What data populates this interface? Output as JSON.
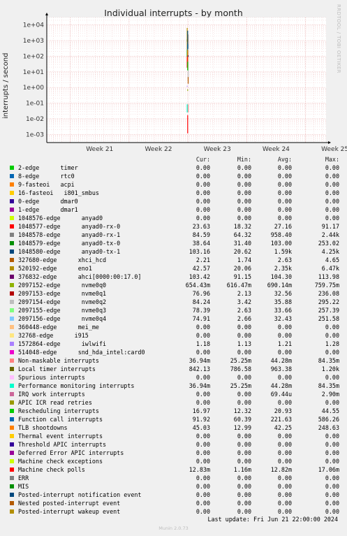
{
  "title": "Individual interrupts - by month",
  "vendor_text": "RRDTOOL / TOBI OETIKER",
  "footer": {
    "last_update": "Last update: Fri Jun 21 22:00:00 2024",
    "munin": "Munin 2.0.73"
  },
  "table": {
    "headers": [
      "Cur:",
      "Min:",
      "Avg:",
      "Max:"
    ],
    "rows": [
      {
        "name": "2-edge      timer",
        "color": "#00cc00",
        "cur": "0.00",
        "min": "0.00",
        "avg": "0.00",
        "max": "0.00"
      },
      {
        "name": "8-edge      rtc0",
        "color": "#0066b3",
        "cur": "0.00",
        "min": "0.00",
        "avg": "0.00",
        "max": "0.00"
      },
      {
        "name": "9-fasteoi   acpi",
        "color": "#ff8000",
        "cur": "0.00",
        "min": "0.00",
        "avg": "0.00",
        "max": "0.00"
      },
      {
        "name": "16-fasteoi   i801_smbus",
        "color": "#ffcc00",
        "cur": "0.00",
        "min": "0.00",
        "avg": "0.00",
        "max": "0.00"
      },
      {
        "name": "0-edge      dmar0",
        "color": "#330099",
        "cur": "0.00",
        "min": "0.00",
        "avg": "0.00",
        "max": "0.00"
      },
      {
        "name": "1-edge      dmar1",
        "color": "#990099",
        "cur": "0.00",
        "min": "0.00",
        "avg": "0.00",
        "max": "0.00"
      },
      {
        "name": "1048576-edge      anyad0",
        "color": "#ccff00",
        "cur": "0.00",
        "min": "0.00",
        "avg": "0.00",
        "max": "0.00"
      },
      {
        "name": "1048577-edge      anyad0-rx-0",
        "color": "#ff0000",
        "cur": "23.63",
        "min": "18.32",
        "avg": "27.16",
        "max": "91.17"
      },
      {
        "name": "1048578-edge      anyad0-rx-1",
        "color": "#808080",
        "cur": "84.59",
        "min": "64.32",
        "avg": "958.40",
        "max": "2.44k"
      },
      {
        "name": "1048579-edge      anyad0-tx-0",
        "color": "#008f00",
        "cur": "38.64",
        "min": "31.40",
        "avg": "103.00",
        "max": "253.02"
      },
      {
        "name": "1048580-edge      anyad0-tx-1",
        "color": "#00487d",
        "cur": "103.16",
        "min": "20.62",
        "avg": "1.59k",
        "max": "4.25k"
      },
      {
        "name": "327680-edge      xhci_hcd",
        "color": "#b35a00",
        "cur": "2.21",
        "min": "1.74",
        "avg": "2.63",
        "max": "4.65"
      },
      {
        "name": "520192-edge      eno1",
        "color": "#b38f00",
        "cur": "42.57",
        "min": "20.06",
        "avg": "2.35k",
        "max": "6.47k"
      },
      {
        "name": "376832-edge      ahci[0000:00:17.0]",
        "color": "#6b006b",
        "cur": "103.42",
        "min": "91.15",
        "avg": "104.30",
        "max": "113.98"
      },
      {
        "name": "2097152-edge      nvme0q0",
        "color": "#8fb300",
        "cur": "654.43m",
        "min": "616.47m",
        "avg": "690.14m",
        "max": "759.75m"
      },
      {
        "name": "2097153-edge      nvme0q1",
        "color": "#b30000",
        "cur": "76.96",
        "min": "2.13",
        "avg": "32.56",
        "max": "236.08"
      },
      {
        "name": "2097154-edge      nvme0q2",
        "color": "#bebebe",
        "cur": "84.24",
        "min": "3.42",
        "avg": "35.88",
        "max": "295.22"
      },
      {
        "name": "2097155-edge      nvme0q3",
        "color": "#80ff80",
        "cur": "78.39",
        "min": "2.63",
        "avg": "33.66",
        "max": "257.39"
      },
      {
        "name": "2097156-edge      nvme0q4",
        "color": "#80c9ff",
        "cur": "74.91",
        "min": "2.66",
        "avg": "32.43",
        "max": "251.58"
      },
      {
        "name": "360448-edge      mei_me",
        "color": "#ffc080",
        "cur": "0.00",
        "min": "0.00",
        "avg": "0.00",
        "max": "0.00"
      },
      {
        "name": "32768-edge      i915",
        "color": "#ffe680",
        "cur": "0.00",
        "min": "0.00",
        "avg": "0.00",
        "max": "0.00"
      },
      {
        "name": "1572864-edge      iwlwifi",
        "color": "#aa80ff",
        "cur": "1.18",
        "min": "1.13",
        "avg": "1.21",
        "max": "1.28"
      },
      {
        "name": "514048-edge      snd_hda_intel:card0",
        "color": "#ee00cc",
        "cur": "0.00",
        "min": "0.00",
        "avg": "0.00",
        "max": "0.00"
      },
      {
        "name": "Non-maskable interrupts",
        "color": "#ff8080",
        "cur": "36.94m",
        "min": "25.25m",
        "avg": "44.28m",
        "max": "84.35m"
      },
      {
        "name": "Local timer interrupts",
        "color": "#666600",
        "cur": "842.13",
        "min": "786.58",
        "avg": "963.38",
        "max": "1.20k"
      },
      {
        "name": "Spurious interrupts",
        "color": "#ffbfff",
        "cur": "0.00",
        "min": "0.00",
        "avg": "0.00",
        "max": "0.00"
      },
      {
        "name": "Performance monitoring interrupts",
        "color": "#00ffcc",
        "cur": "36.94m",
        "min": "25.25m",
        "avg": "44.28m",
        "max": "84.35m"
      },
      {
        "name": "IRQ work interrupts",
        "color": "#cc6699",
        "cur": "0.00",
        "min": "0.00",
        "avg": "69.44u",
        "max": "2.90m"
      },
      {
        "name": "APIC ICR read retries",
        "color": "#999900",
        "cur": "0.00",
        "min": "0.00",
        "avg": "0.00",
        "max": "0.00"
      },
      {
        "name": "Rescheduling interrupts",
        "color": "#00cc00",
        "cur": "16.97",
        "min": "12.32",
        "avg": "20.93",
        "max": "44.55"
      },
      {
        "name": "Function call interrupts",
        "color": "#0066b3",
        "cur": "91.92",
        "min": "60.39",
        "avg": "221.63",
        "max": "586.26"
      },
      {
        "name": "TLB shootdowns",
        "color": "#ff8000",
        "cur": "45.03",
        "min": "12.99",
        "avg": "42.25",
        "max": "248.63"
      },
      {
        "name": "Thermal event interrupts",
        "color": "#ffcc00",
        "cur": "0.00",
        "min": "0.00",
        "avg": "0.00",
        "max": "0.00"
      },
      {
        "name": "Threshold APIC interrupts",
        "color": "#330099",
        "cur": "0.00",
        "min": "0.00",
        "avg": "0.00",
        "max": "0.00"
      },
      {
        "name": "Deferred Error APIC interrupts",
        "color": "#990099",
        "cur": "0.00",
        "min": "0.00",
        "avg": "0.00",
        "max": "0.00"
      },
      {
        "name": "Machine check exceptions",
        "color": "#ccff00",
        "cur": "0.00",
        "min": "0.00",
        "avg": "0.00",
        "max": "0.00"
      },
      {
        "name": "Machine check polls",
        "color": "#ff0000",
        "cur": "12.83m",
        "min": "1.16m",
        "avg": "12.82m",
        "max": "17.06m"
      },
      {
        "name": "ERR",
        "color": "#808080",
        "cur": "0.00",
        "min": "0.00",
        "avg": "0.00",
        "max": "0.00"
      },
      {
        "name": "MIS",
        "color": "#008f00",
        "cur": "0.00",
        "min": "0.00",
        "avg": "0.00",
        "max": "0.00"
      },
      {
        "name": "Posted-interrupt notification event",
        "color": "#00487d",
        "cur": "0.00",
        "min": "0.00",
        "avg": "0.00",
        "max": "0.00"
      },
      {
        "name": "Nested posted-interrupt event",
        "color": "#b35a00",
        "cur": "0.00",
        "min": "0.00",
        "avg": "0.00",
        "max": "0.00"
      },
      {
        "name": "Posted-interrupt wakeup event",
        "color": "#b38f00",
        "cur": "0.00",
        "min": "0.00",
        "avg": "0.00",
        "max": "0.00"
      }
    ]
  },
  "chart_data": {
    "type": "line",
    "title": "Individual interrupts - by month",
    "ylabel": "interrupts / second",
    "xlabel": "",
    "yscale": "log",
    "ylim": [
      0.0003,
      30000
    ],
    "y_ticks": [
      "1e-03",
      "1e-02",
      "1e-01",
      "1e+00",
      "1e+01",
      "1e+02",
      "1e+03",
      "1e+04"
    ],
    "x_ticks": [
      "Week 21",
      "Week 22",
      "Week 23",
      "Week 24",
      "Week 25"
    ],
    "grid": true,
    "note": "Data appears only in a narrow window around the start of Week 23.",
    "series_marks": [
      {
        "name": "eno1",
        "color": "#b38f00",
        "values": [
          6470,
          2350,
          42.57
        ]
      },
      {
        "name": "anyad0-tx-1",
        "color": "#00487d",
        "values": [
          4250,
          1590,
          103.16
        ]
      },
      {
        "name": "anyad0-rx-1",
        "color": "#808080",
        "values": [
          2440,
          958.4,
          84.59
        ]
      },
      {
        "name": "Local timer interrupts",
        "color": "#666600",
        "values": [
          1200,
          963.38,
          842.13
        ]
      },
      {
        "name": "Function call interrupts",
        "color": "#0066b3",
        "values": [
          586.26,
          221.63,
          91.92
        ]
      },
      {
        "name": "nvme0q2",
        "color": "#bebebe",
        "values": [
          295.22,
          35.88,
          3.42
        ]
      },
      {
        "name": "anyad0-tx-0",
        "color": "#008f00",
        "values": [
          253.02,
          103.0,
          31.4
        ]
      },
      {
        "name": "TLB shootdowns",
        "color": "#ff8000",
        "values": [
          248.63,
          42.25,
          12.99
        ]
      },
      {
        "name": "ahci[0000:00:17.0]",
        "color": "#6b006b",
        "values": [
          113.98,
          104.3,
          91.15
        ]
      },
      {
        "name": "anyad0-rx-0",
        "color": "#ff0000",
        "values": [
          91.17,
          27.16,
          18.32
        ]
      },
      {
        "name": "Rescheduling interrupts",
        "color": "#00cc00",
        "values": [
          44.55,
          20.93,
          12.32
        ]
      },
      {
        "name": "xhci_hcd",
        "color": "#b35a00",
        "values": [
          4.65,
          2.63,
          1.74
        ]
      },
      {
        "name": "iwlwifi",
        "color": "#aa80ff",
        "values": [
          1.28,
          1.21,
          1.13
        ]
      },
      {
        "name": "nvme0q0",
        "color": "#8fb300",
        "values": [
          0.7598,
          0.6901,
          0.6165
        ]
      },
      {
        "name": "Non-maskable interrupts",
        "color": "#ff8080",
        "values": [
          0.0844,
          0.0443,
          0.0253
        ]
      },
      {
        "name": "Performance monitoring interrupts",
        "color": "#00ffcc",
        "values": [
          0.0844,
          0.0443,
          0.0253
        ]
      },
      {
        "name": "Machine check polls",
        "color": "#ff0000",
        "values": [
          0.0171,
          0.0128,
          0.00116
        ]
      }
    ]
  }
}
